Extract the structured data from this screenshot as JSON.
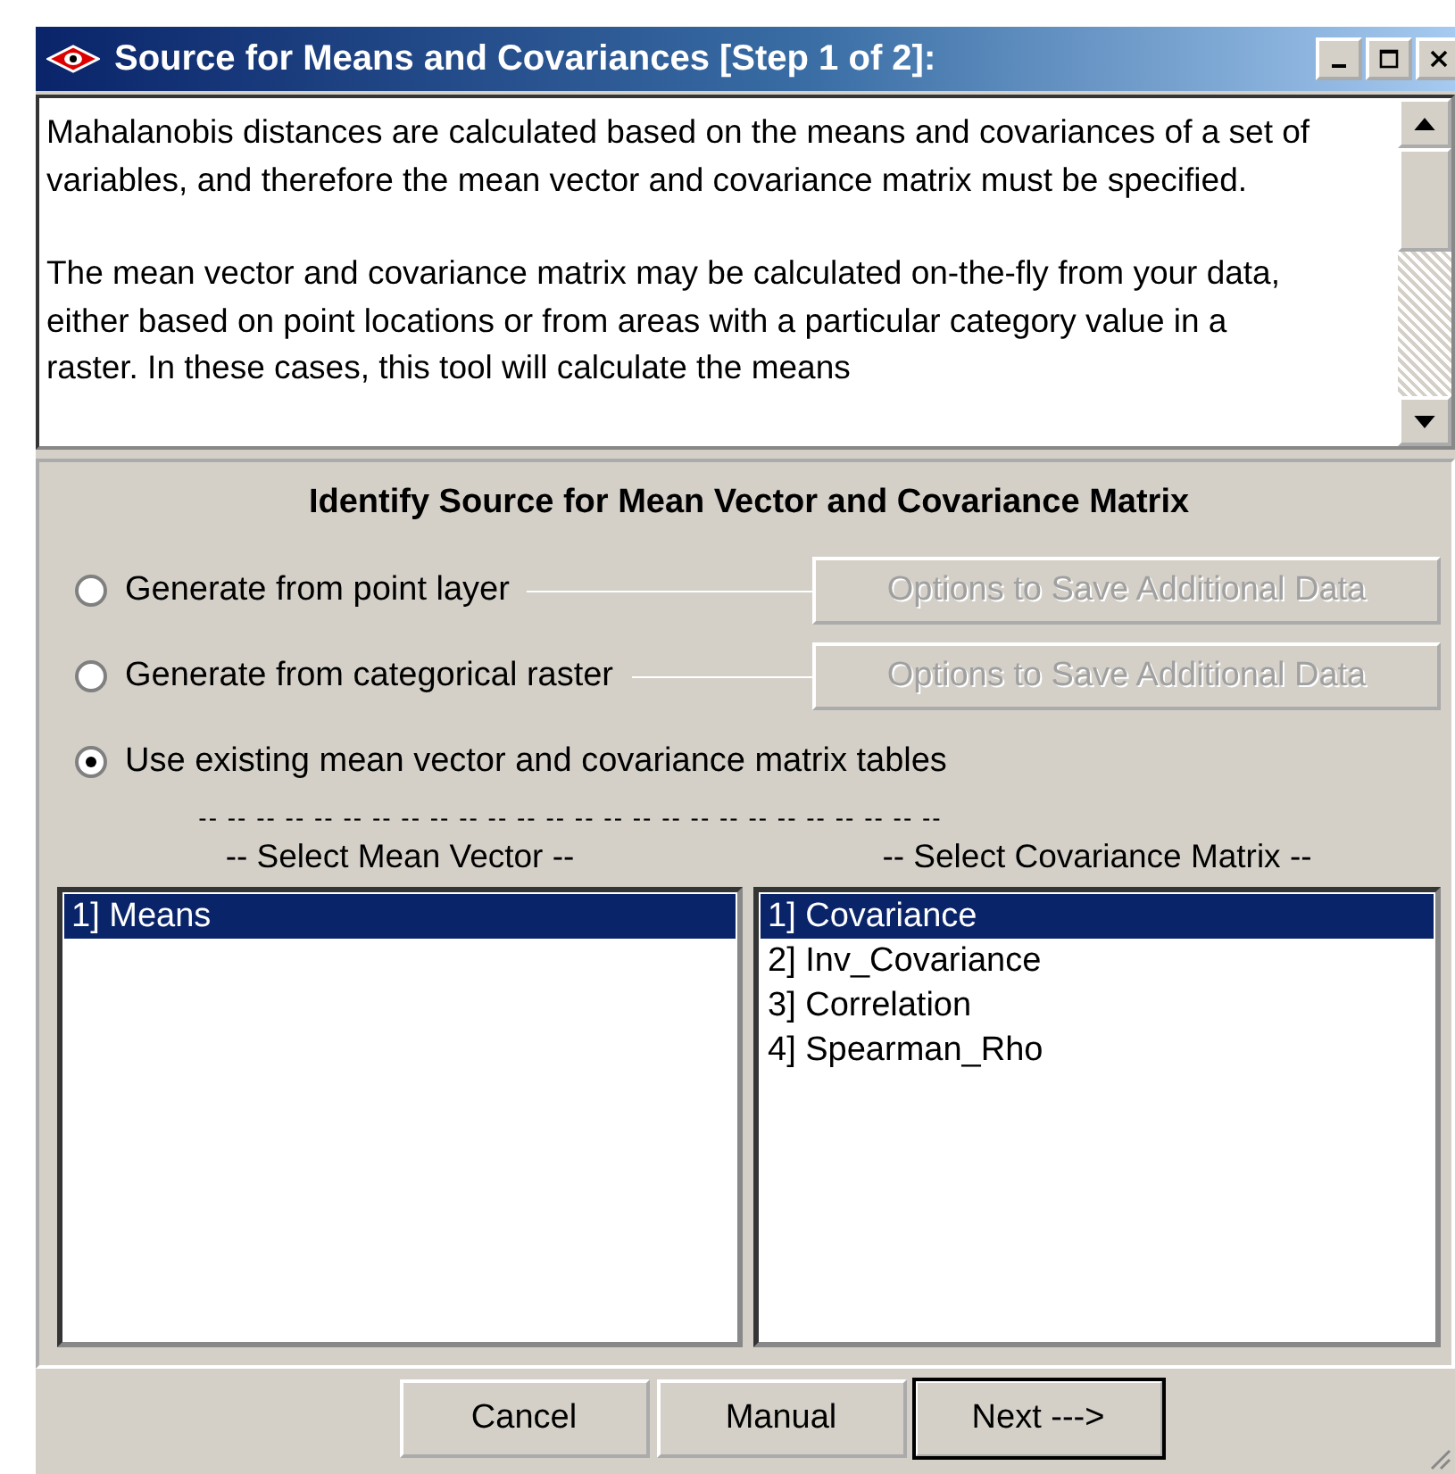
{
  "window": {
    "title": "Source for Means and Covariances [Step 1 of 2]:"
  },
  "description": [
    "Mahalanobis distances are calculated based on the means and covariances of a set of variables, and therefore the mean vector and covariance matrix must be specified.",
    "The mean vector and covariance matrix may be calculated on-the-fly from your data, either based on point locations or from areas with a particular category value in a raster.  In these cases, this tool will calculate the means"
  ],
  "panel": {
    "heading": "Identify Source for Mean Vector and Covariance Matrix",
    "sources": [
      {
        "label": "Generate from point layer",
        "selected": false,
        "options_button": {
          "label": "Options to Save Additional Data",
          "disabled": true
        }
      },
      {
        "label": "Generate from categorical raster",
        "selected": false,
        "options_button": {
          "label": "Options to Save Additional Data",
          "disabled": true
        }
      },
      {
        "label": "Use existing mean vector and covariance matrix tables",
        "selected": true
      }
    ],
    "separator": "-- -- -- -- -- -- -- -- -- -- -- -- -- -- -- -- -- -- -- -- -- -- -- -- -- --",
    "lists": [
      {
        "heading": "-- Select Mean Vector --",
        "items": [
          {
            "label": "1]  Means",
            "selected": true
          }
        ]
      },
      {
        "heading": "-- Select Covariance Matrix --",
        "items": [
          {
            "label": "1]  Covariance",
            "selected": true
          },
          {
            "label": "2]  Inv_Covariance",
            "selected": false
          },
          {
            "label": "3]  Correlation",
            "selected": false
          },
          {
            "label": "4]  Spearman_Rho",
            "selected": false
          }
        ]
      }
    ]
  },
  "buttons": [
    {
      "label": "Cancel",
      "default": false
    },
    {
      "label": "Manual",
      "default": false
    },
    {
      "label": "Next --->",
      "default": true
    }
  ]
}
